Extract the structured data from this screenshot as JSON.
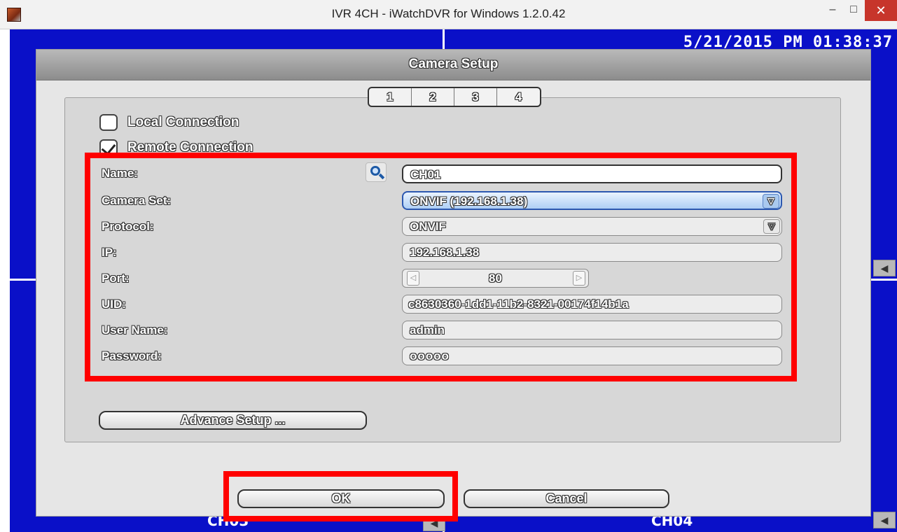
{
  "window": {
    "title": "IVR 4CH - iWatchDVR for Windows 1.2.0.42",
    "minimize": "–",
    "maximize": "□",
    "close": "✕"
  },
  "dvr": {
    "datetime": "5/21/2015 PM 01:38:37",
    "channels": [
      "CH03",
      "CH04"
    ]
  },
  "dialog": {
    "title": "Camera Setup",
    "tabs": [
      "1",
      "2",
      "3",
      "4"
    ],
    "local_connection": "Local Connection",
    "remote_connection": "Remote Connection",
    "fields": {
      "name_label": "Name:",
      "name_value": "CH01",
      "camera_set_label": "Camera Set:",
      "camera_set_value": "ONVIF (192.168.1.38)",
      "protocol_label": "Protocol:",
      "protocol_value": "ONVIF",
      "ip_label": "IP:",
      "ip_value": "192.168.1.38",
      "port_label": "Port:",
      "port_value": "80",
      "uid_label": "UID:",
      "uid_value": "c8630360-1dd1-11b2-8321-00174f14b1a",
      "username_label": "User Name:",
      "username_value": "admin",
      "password_label": "Password:",
      "password_value": "ooooo"
    },
    "advance_setup": "Advance Setup ...",
    "ok": "OK",
    "cancel": "Cancel"
  },
  "icons": {
    "speaker": "◀",
    "dropdown": "▽",
    "step_left": "◁",
    "step_right": "▷"
  },
  "colors": {
    "dvr_background": "#0a10c8",
    "highlight_red": "#ff0000",
    "close_button": "#c7352b"
  }
}
